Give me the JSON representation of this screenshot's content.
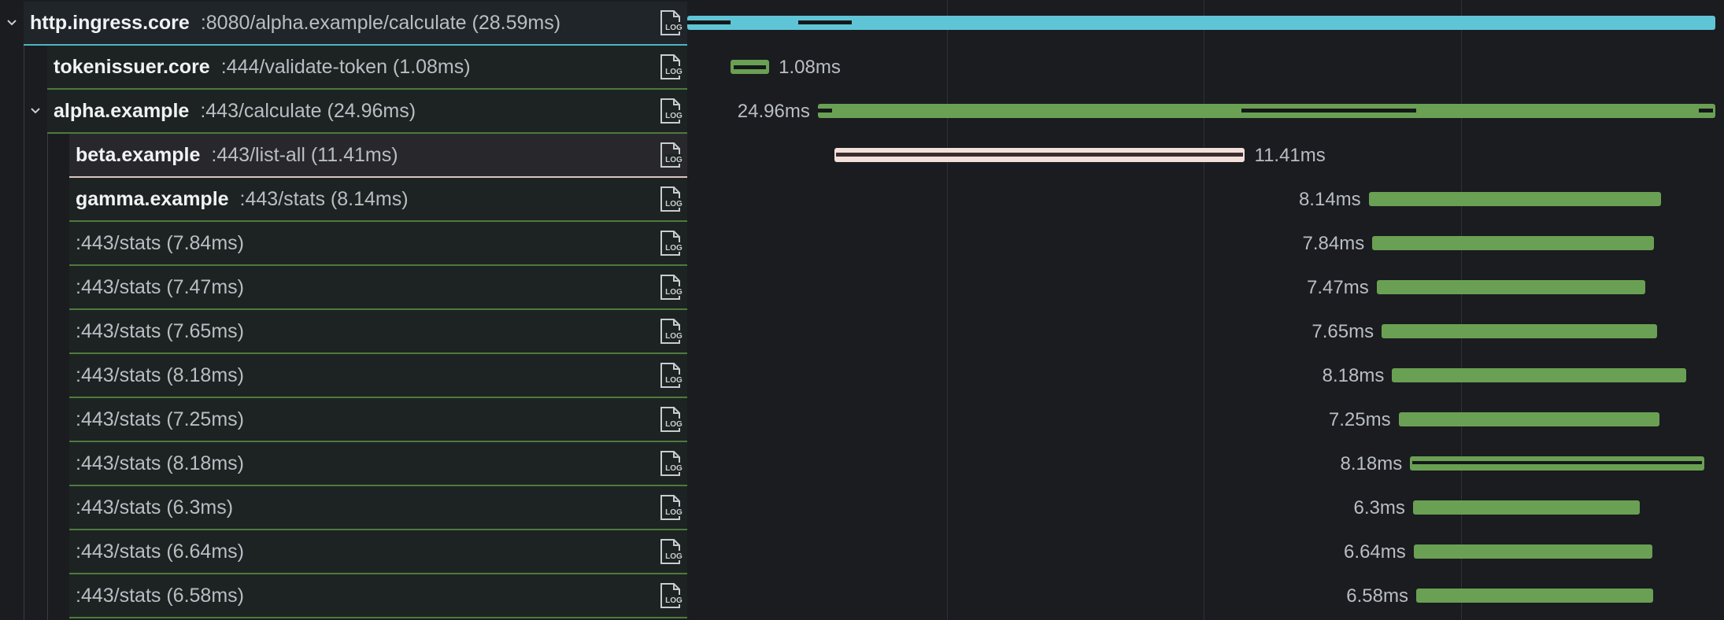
{
  "colors": {
    "root": "#5fc4d6",
    "child": "#6aa053",
    "selected": "#f3e0db",
    "highlight": "#6aa053"
  },
  "icons": {
    "expand": "chevron-down-icon",
    "log": "log-file-icon"
  },
  "timeline": {
    "total_ms": 28.59
  },
  "spans": [
    {
      "service": "http.ingress.core",
      "operation": ":8080/alpha.example/calculate (28.59ms)",
      "duration": "",
      "start_ms": 0,
      "dur_ms": 28.59,
      "depth": 0,
      "expanded": true,
      "color": "root",
      "label_side": "none"
    },
    {
      "service": "tokenissuer.core",
      "operation": ":444/validate-token (1.08ms)",
      "duration": "1.08ms",
      "start_ms": 1.2,
      "dur_ms": 1.08,
      "depth": 1,
      "expanded": null,
      "color": "child",
      "label_side": "right",
      "style": "hollow"
    },
    {
      "service": "alpha.example",
      "operation": ":443/calculate (24.96ms)",
      "duration": "24.96ms",
      "start_ms": 3.63,
      "dur_ms": 24.96,
      "depth": 1,
      "expanded": true,
      "color": "child",
      "label_side": "left",
      "style": "child-segs"
    },
    {
      "service": "beta.example",
      "operation": ":443/list-all (11.41ms)",
      "duration": "11.41ms",
      "start_ms": 4.1,
      "dur_ms": 11.41,
      "depth": 2,
      "expanded": null,
      "color": "selected",
      "label_side": "right",
      "style": "selected"
    },
    {
      "service": "gamma.example",
      "operation": ":443/stats (8.14ms)",
      "duration": "8.14ms",
      "start_ms": 18.95,
      "dur_ms": 8.14,
      "depth": 2,
      "expanded": null,
      "color": "child",
      "label_side": "left"
    },
    {
      "service": "",
      "operation": ":443/stats (7.84ms)",
      "duration": "7.84ms",
      "start_ms": 19.05,
      "dur_ms": 7.84,
      "depth": 2,
      "expanded": null,
      "color": "child",
      "label_side": "left"
    },
    {
      "service": "",
      "operation": ":443/stats (7.47ms)",
      "duration": "7.47ms",
      "start_ms": 19.17,
      "dur_ms": 7.47,
      "depth": 2,
      "expanded": null,
      "color": "child",
      "label_side": "left"
    },
    {
      "service": "",
      "operation": ":443/stats (7.65ms)",
      "duration": "7.65ms",
      "start_ms": 19.31,
      "dur_ms": 7.65,
      "depth": 2,
      "expanded": null,
      "color": "child",
      "label_side": "left"
    },
    {
      "service": "",
      "operation": ":443/stats (8.18ms)",
      "duration": "8.18ms",
      "start_ms": 19.6,
      "dur_ms": 8.18,
      "depth": 2,
      "expanded": null,
      "color": "child",
      "label_side": "left"
    },
    {
      "service": "",
      "operation": ":443/stats (7.25ms)",
      "duration": "7.25ms",
      "start_ms": 19.78,
      "dur_ms": 7.25,
      "depth": 2,
      "expanded": null,
      "color": "child",
      "label_side": "left"
    },
    {
      "service": "",
      "operation": ":443/stats (8.18ms)",
      "duration": "8.18ms",
      "start_ms": 20.1,
      "dur_ms": 8.18,
      "depth": 2,
      "expanded": null,
      "color": "child",
      "label_side": "left",
      "style": "highlight"
    },
    {
      "service": "",
      "operation": ":443/stats (6.3ms)",
      "duration": "6.3ms",
      "start_ms": 20.18,
      "dur_ms": 6.3,
      "depth": 2,
      "expanded": null,
      "color": "child",
      "label_side": "left"
    },
    {
      "service": "",
      "operation": ":443/stats (6.64ms)",
      "duration": "6.64ms",
      "start_ms": 20.2,
      "dur_ms": 6.64,
      "depth": 2,
      "expanded": null,
      "color": "child",
      "label_side": "left"
    },
    {
      "service": "",
      "operation": ":443/stats (6.58ms)",
      "duration": "6.58ms",
      "start_ms": 20.27,
      "dur_ms": 6.58,
      "depth": 2,
      "expanded": null,
      "color": "child",
      "label_side": "left"
    }
  ]
}
